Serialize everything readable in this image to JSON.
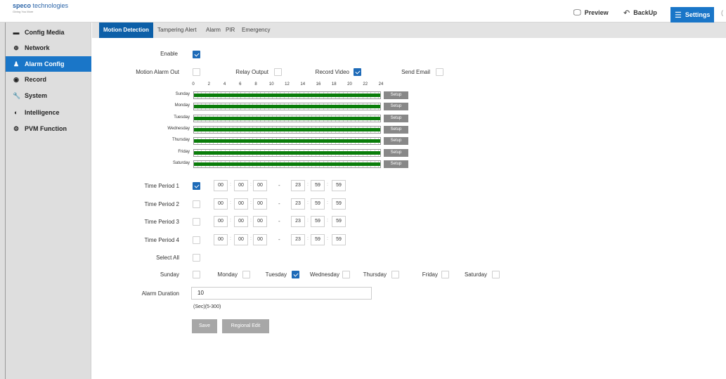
{
  "brand": {
    "name_bold": "speco",
    "name_rest": " technologies",
    "tagline": "Giving You More"
  },
  "topnav": {
    "preview": "Preview",
    "backup": "BackUp",
    "settings": "Settings",
    "preview_icon": "monitor-icon",
    "backup_icon": "undo-icon",
    "settings_icon": "list-icon"
  },
  "sidebar": {
    "items": [
      {
        "label": "Config Media",
        "icon": "media-icon",
        "glyph": "▬"
      },
      {
        "label": "Network",
        "icon": "globe-icon",
        "glyph": "⊕"
      },
      {
        "label": "Alarm Config",
        "icon": "user-icon",
        "glyph": "♟"
      },
      {
        "label": "Record",
        "icon": "record-icon",
        "glyph": "◉"
      },
      {
        "label": "System",
        "icon": "wrench-icon",
        "glyph": "🔧"
      },
      {
        "label": "Intelligence",
        "icon": "intelligence-icon",
        "glyph": "◐"
      },
      {
        "label": "PVM Function",
        "icon": "gear-icon",
        "glyph": "⚙"
      }
    ],
    "active_index": 2
  },
  "tabs": [
    "Motion Detection",
    "Tampering Alert",
    "Alarm",
    "PIR",
    "Emergency"
  ],
  "form": {
    "enable_label": "Enable",
    "enable_checked": true,
    "motion_alarm_out_label": "Motion Alarm Out",
    "relay_output_label": "Relay Output",
    "record_video_label": "Record Video",
    "send_email_label": "Send Email",
    "motion_alarm_out": false,
    "relay_output": false,
    "record_video": true,
    "send_email": false
  },
  "schedule": {
    "hours": [
      "0",
      "2",
      "4",
      "6",
      "8",
      "10",
      "12",
      "14",
      "16",
      "18",
      "20",
      "22",
      "24"
    ],
    "days": [
      "Sunday",
      "Monday",
      "Tuesday",
      "Wednesday",
      "Thursday",
      "Friday",
      "Saturday"
    ],
    "setup_label": "Setup",
    "bar_color": "#0a7d0a"
  },
  "time_periods": [
    {
      "label": "Time Period 1",
      "checked": true,
      "start": [
        "00",
        "00",
        "00"
      ],
      "end": [
        "23",
        "59",
        "59"
      ]
    },
    {
      "label": "Time Period 2",
      "checked": false,
      "start": [
        "00",
        "00",
        "00"
      ],
      "end": [
        "23",
        "59",
        "59"
      ]
    },
    {
      "label": "Time Period 3",
      "checked": false,
      "start": [
        "00",
        "00",
        "00"
      ],
      "end": [
        "23",
        "59",
        "59"
      ]
    },
    {
      "label": "Time Period 4",
      "checked": false,
      "start": [
        "00",
        "00",
        "00"
      ],
      "end": [
        "23",
        "59",
        "59"
      ]
    }
  ],
  "select_all_label": "Select All",
  "weekdays": [
    {
      "label": "Sunday",
      "checked": false
    },
    {
      "label": "Monday",
      "checked": false
    },
    {
      "label": "Tuesday",
      "checked": true
    },
    {
      "label": "Wednesday",
      "checked": false
    },
    {
      "label": "Thursday",
      "checked": false
    },
    {
      "label": "Friday",
      "checked": false
    },
    {
      "label": "Saturday",
      "checked": false
    }
  ],
  "alarm_duration": {
    "label": "Alarm Duration",
    "value": "10",
    "hint": "(Sec)(5-300)"
  },
  "buttons": {
    "save": "Save",
    "regional_edit": "Regional Edit"
  },
  "colors": {
    "accent": "#1a76c8",
    "tab_active": "#0c5fa8",
    "checkbox_on": "#1e6bb8"
  }
}
